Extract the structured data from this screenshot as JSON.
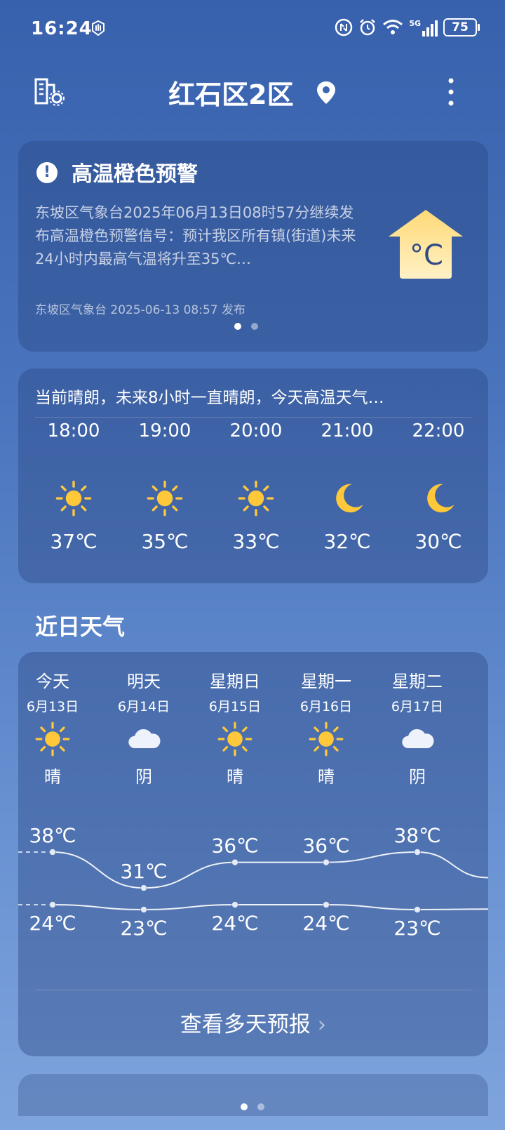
{
  "status_bar": {
    "time": "16:24",
    "battery": "75",
    "network": "5G"
  },
  "header": {
    "city": "红石区2区"
  },
  "alert": {
    "title": "高温橙色预警",
    "body": "东坡区气象台2025年06月13日08时57分继续发布高温橙色预警信号：预计我区所有镇(街道)未来24小时内最高气温将升至35℃…",
    "source": "东坡区气象台 2025-06-13 08:57 发布",
    "thermo_label": "°C"
  },
  "hourly": {
    "summary": "当前晴朗，未来8小时一直晴朗，今天高温天气…",
    "items": [
      {
        "time": "18:00",
        "icon": "sun-icon",
        "temp": "37℃"
      },
      {
        "time": "19:00",
        "icon": "sun-icon",
        "temp": "35℃"
      },
      {
        "time": "20:00",
        "icon": "sun-icon",
        "temp": "33℃"
      },
      {
        "time": "21:00",
        "icon": "moon-icon",
        "temp": "32℃"
      },
      {
        "time": "22:00",
        "icon": "moon-icon",
        "temp": "30℃"
      }
    ]
  },
  "daily": {
    "title": "近日天气",
    "days": [
      {
        "name": "今天",
        "date": "6月13日",
        "icon": "sun-icon",
        "cond": "晴",
        "high": "38℃",
        "low": "24℃",
        "high_v": 38,
        "low_v": 24
      },
      {
        "name": "明天",
        "date": "6月14日",
        "icon": "cloud-icon",
        "cond": "阴",
        "high": "31℃",
        "low": "23℃",
        "high_v": 31,
        "low_v": 23
      },
      {
        "name": "星期日",
        "date": "6月15日",
        "icon": "sun-icon",
        "cond": "晴",
        "high": "36℃",
        "low": "24℃",
        "high_v": 36,
        "low_v": 24
      },
      {
        "name": "星期一",
        "date": "6月16日",
        "icon": "sun-icon",
        "cond": "晴",
        "high": "36℃",
        "low": "24℃",
        "high_v": 36,
        "low_v": 24
      },
      {
        "name": "星期二",
        "date": "6月17日",
        "icon": "cloud-icon",
        "cond": "阴",
        "high": "38℃",
        "low": "23℃",
        "high_v": 38,
        "low_v": 23
      }
    ],
    "more_label": "查看多天预报"
  },
  "colors": {
    "sun": "#ffc83a",
    "moon": "#ffc83a",
    "cloud": "#eef3fb"
  }
}
